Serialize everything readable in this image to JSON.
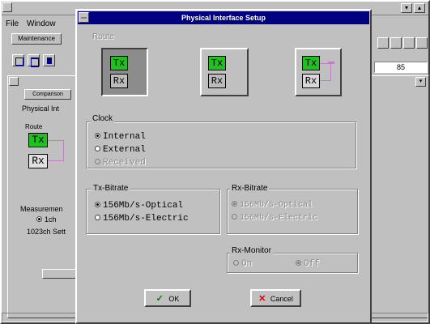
{
  "app": {
    "menu": {
      "file": "File",
      "window": "Window"
    },
    "toolbar": {
      "maintenance": "Maintenance"
    },
    "tab_label": "Comparison",
    "panel_label": "Physical Int",
    "route_label": "Route",
    "measurement_label": "Measuremen",
    "measurement_option": "1ch",
    "setting_label": "1023ch Sett",
    "right_field": "85"
  },
  "dialog": {
    "title": "Physical Interface Setup",
    "route": {
      "label": "Route",
      "options": [
        {
          "tx": "Tx",
          "rx": "Rx",
          "selected": true
        },
        {
          "tx": "Tx",
          "rx": "Rx",
          "selected": false
        },
        {
          "tx": "Tx",
          "rx": "Rx",
          "selected": false
        }
      ]
    },
    "clock": {
      "label": "Clock",
      "options": [
        {
          "label": "Internal",
          "checked": true,
          "disabled": false
        },
        {
          "label": "External",
          "checked": false,
          "disabled": false
        },
        {
          "label": "Received",
          "checked": false,
          "disabled": true
        }
      ]
    },
    "tx_bitrate": {
      "label": "Tx-Bitrate",
      "options": [
        {
          "label": "156Mb/s-Optical",
          "checked": true
        },
        {
          "label": "156Mb/s-Electric",
          "checked": false
        }
      ]
    },
    "rx_bitrate": {
      "label": "Rx-Bitrate",
      "options": [
        {
          "label": "156Mb/s-Optical",
          "checked": true
        },
        {
          "label": "156Mb/s-Electric",
          "checked": false
        }
      ]
    },
    "rx_monitor": {
      "label": "Rx-Monitor",
      "options": [
        {
          "label": "On",
          "checked": false
        },
        {
          "label": "Off",
          "checked": true
        }
      ]
    },
    "ok_label": "OK",
    "cancel_label": "Cancel"
  },
  "colors": {
    "title_bar": "#000080",
    "tx_green": "#21c021",
    "face": "#c0c0c0",
    "link": "#c080c0"
  }
}
